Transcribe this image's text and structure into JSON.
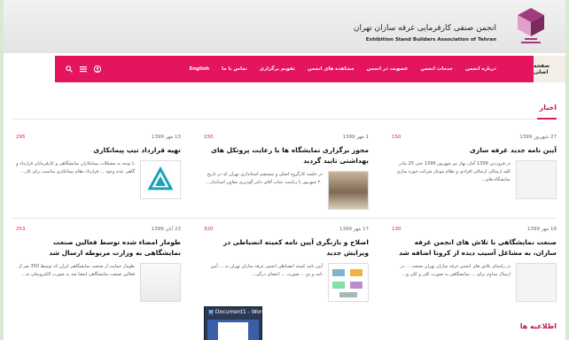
{
  "header": {
    "association_fa": "انجمن صنفی کارفرمایی غرفه سازان تهران",
    "association_en": "Exhibition Stand Builders Association of Tehran",
    "logo_icon": "association-logo-icon"
  },
  "nav": {
    "home": "صفحه اصلی",
    "items": [
      "درباره انجمن",
      "خدمات انجمن",
      "عضویت در انجمن",
      "مشاهده های انجمن",
      "تقویم برگزاری",
      "تماس با ما",
      "English"
    ],
    "icons": [
      "search-icon",
      "menu-icon",
      "account-icon"
    ],
    "accent_color": "#e4155e"
  },
  "news": {
    "title": "اخبار",
    "items": [
      {
        "date": "27 شهریور 1399",
        "views": "150",
        "title": "آیین نامه جدید غرفه سازی",
        "excerpt": "در فروردین 1399 آغاز، بهار تیر شهریور 1399 حتی 25 مادر کلیه ارسالی ارسالی افرادی و نظام مونتاژ شرکت حوزه سازی نمایشگاه های...",
        "thumb": "document-thumbnail"
      },
      {
        "date": "1 مهر 1399",
        "views": "150",
        "title": "مجوز برگزاری نمایشگاه ها با رعایت پروتکل های بهداشتی تایید گردید",
        "excerpt": "در جلسه کارگروه اصلی و مستقیم استانداری تهران که در تاریخ ۲۰ شهریور با ریاست جناب آقای دکتر گودرزی معاون استاندار...",
        "thumb": "conference-room-photo"
      },
      {
        "date": "13 مهر 1399",
        "views": "295",
        "title": "تهیه قرارداد تیپ پیمانکاری",
        "excerpt": "با توجه به مشکلات پیمانکاران نمایشگاهی و کارفرمایان قرارداد و گاهی عدم وجود ... قرارداد نظام پیمانکاری مناسب برای کار...",
        "thumb": "association-logo"
      },
      {
        "date": "19 مهر 1399",
        "views": "130",
        "title": "صنعت نمایشگاهی با تلاش های انجمن غرفه سازان، به مشاغل آسیب دیده از کرونا اضافه شد",
        "excerpt": "در راستای تلاش های انجمن غرفه سازان تهران صنعت ... در ارسال مداوم برای ... نمایشگاهی به صورت کلی و کلی و...",
        "thumb": "document-thumbnail"
      },
      {
        "date": "17 مهر 1399",
        "views": "320",
        "title": "اصلاح و بازنگری آیین نامه کمیته انضباطی در ویرایش جدید",
        "excerpt": "آیین نامه کمیته انضباطی انجمن غرفه سازان تهران به ... آیین نامه و دو ... صورت ... اعضای درگیر...",
        "thumb": "diagram-thumbnail"
      },
      {
        "date": "23 آبان 1399",
        "views": "253",
        "title": "طومار امضاء شده توسط فعالین صنعت نمایشگاهی به وزارت مربوطه ارسال شد",
        "excerpt": "طومار حمایت از صنعت نمایشگاهی ایران که توسط 350 نفر از فعالین صنعت نمایشگاهی امضا شد به صورت الکترونیکی به...",
        "thumb": "signature-paper-photo"
      }
    ]
  },
  "announcements": {
    "title": "اطلاعیه ها"
  },
  "taskbar_popup": {
    "title": "Document1 - Word",
    "icon": "word-icon"
  }
}
